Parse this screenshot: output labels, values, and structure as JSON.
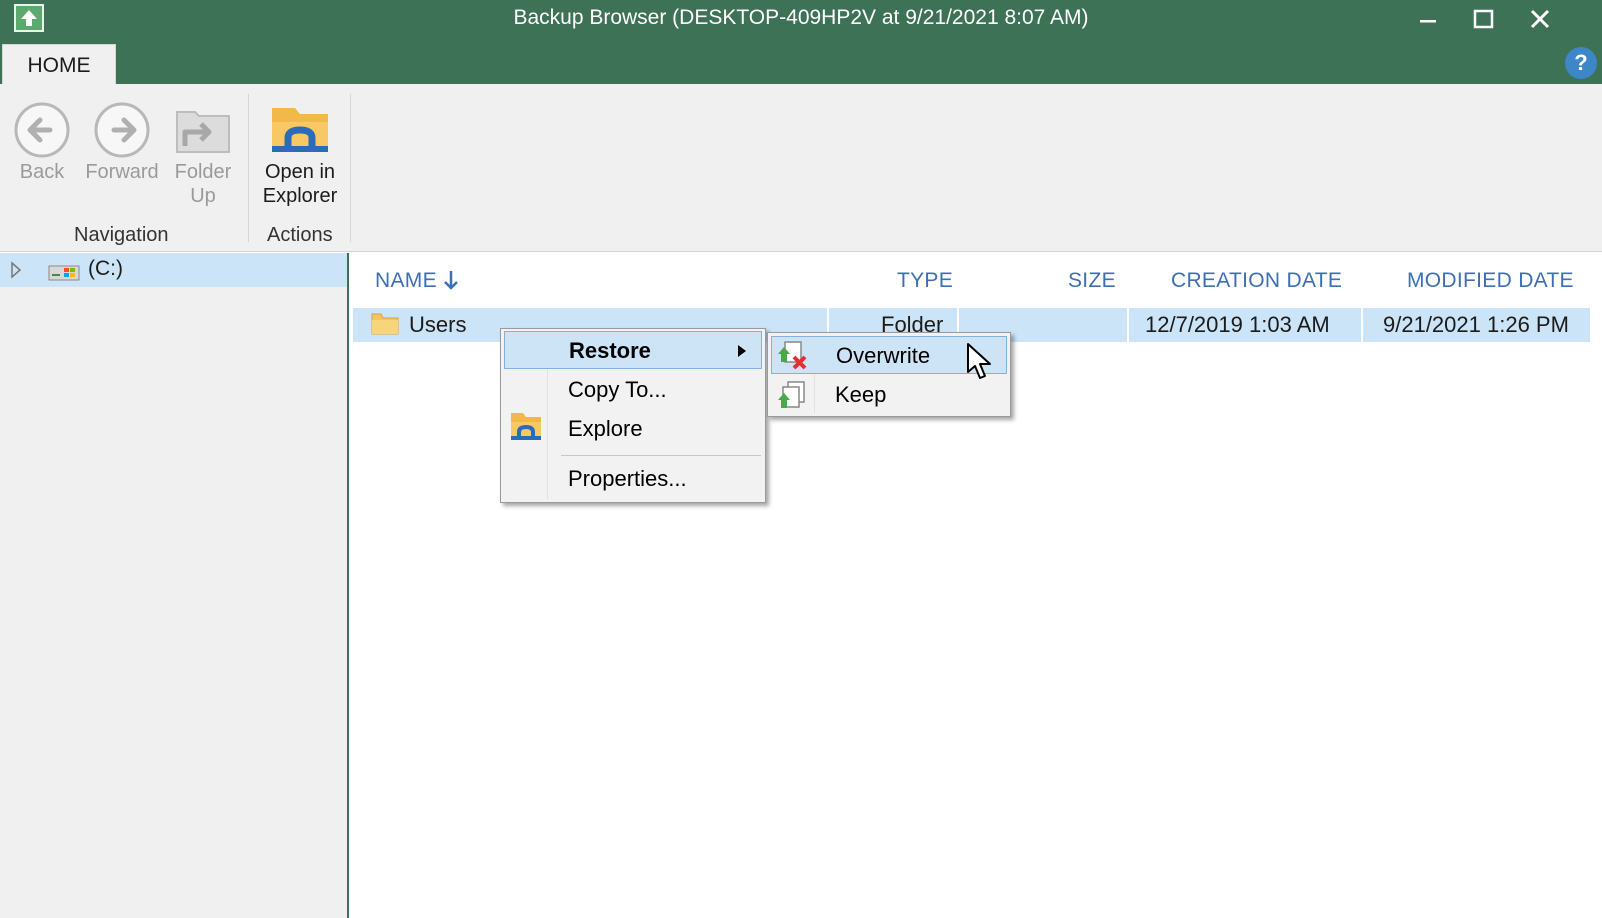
{
  "window": {
    "title": "Backup Browser (DESKTOP-409HP2V at 9/21/2021 8:07 AM)",
    "tab": "HOME",
    "help": "?"
  },
  "ribbon": {
    "back": "Back",
    "forward": "Forward",
    "folder_up": [
      "Folder",
      "Up"
    ],
    "open_in_explorer": [
      "Open in",
      "Explorer"
    ],
    "navigation_group": "Navigation",
    "actions_group": "Actions"
  },
  "tree": {
    "drive": "(C:)"
  },
  "list": {
    "columns": {
      "name": "NAME",
      "type": "TYPE",
      "size": "SIZE",
      "creation_date": "CREATION DATE",
      "modified_date": "MODIFIED DATE"
    },
    "rows": [
      {
        "name": "Users",
        "type": "Folder",
        "size": "",
        "creation_date": "12/7/2019 1:03 AM",
        "modified_date": "9/21/2021 1:26 PM"
      }
    ]
  },
  "context_menu": {
    "restore": "Restore",
    "copy_to": "Copy To...",
    "explore": "Explore",
    "properties": "Properties..."
  },
  "submenu": {
    "overwrite": "Overwrite",
    "keep": "Keep"
  },
  "colors": {
    "titlebar": "#3e7256",
    "selection": "#cce4f7",
    "column_header": "#3d6fb4"
  }
}
